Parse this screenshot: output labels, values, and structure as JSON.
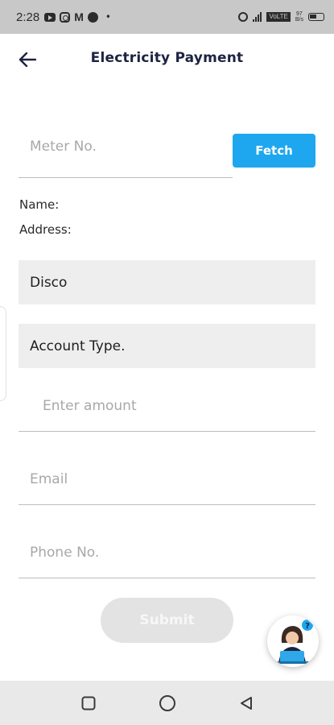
{
  "status_bar": {
    "time": "2:28",
    "mail_glyph": "M",
    "dot": "•",
    "volte": "VoLTE",
    "speed_value": "97",
    "speed_unit": "B/s",
    "left_icons": [
      "youtube-icon",
      "instagram-icon",
      "gmail-icon",
      "phone-icon"
    ],
    "right_icons": [
      "hotspot-icon",
      "signal-icon",
      "volte-icon",
      "battery-icon"
    ]
  },
  "header": {
    "title": "Electricity Payment",
    "back_icon": "arrow-left-icon"
  },
  "meter": {
    "placeholder": "Meter No.",
    "value": "",
    "fetch_label": "Fetch"
  },
  "customer": {
    "name_label": "Name:",
    "address_label": "Address:"
  },
  "disco": {
    "label": "Disco"
  },
  "account_type": {
    "label": "Account Type."
  },
  "amount": {
    "placeholder": "Enter amount",
    "value": ""
  },
  "email": {
    "placeholder": "Email",
    "value": ""
  },
  "phone": {
    "placeholder": "Phone No.",
    "value": ""
  },
  "submit": {
    "label": "Submit",
    "enabled": false
  },
  "support": {
    "icon": "customer-support-icon"
  },
  "nav": {
    "icons": [
      "recents-square-icon",
      "home-circle-icon",
      "back-triangle-icon"
    ]
  },
  "colors": {
    "accent": "#1ea7ef",
    "title": "#1d2340",
    "field_bg": "#eeeeee",
    "disabled_button": "#e3e3e3",
    "status_bar": "#c8c8c8",
    "nav_bar": "#e9e9e9"
  }
}
